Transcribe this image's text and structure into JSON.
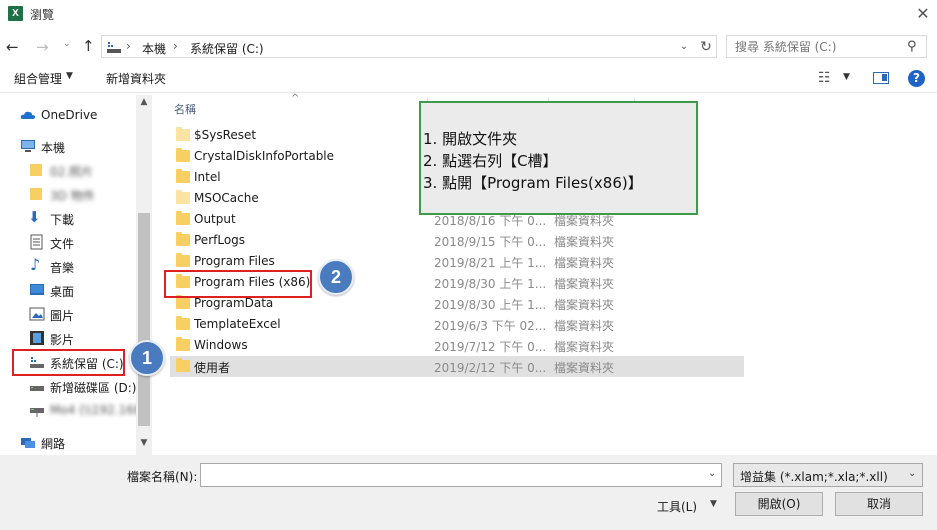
{
  "window": {
    "title": "瀏覽",
    "app_icon_letter": "X"
  },
  "address": {
    "crumbs": [
      "本機",
      "系統保留 (C:)"
    ],
    "separator": "›"
  },
  "search": {
    "placeholder": "搜尋 系統保留 (C:)"
  },
  "toolbar": {
    "organize": "組合管理",
    "new_folder": "新增資料夾"
  },
  "nav": {
    "items": [
      {
        "label": "OneDrive",
        "icon": "cloud-icon"
      },
      {
        "label": "本機",
        "icon": "computer-icon"
      },
      {
        "label": "02.照片",
        "icon": "folder-icon",
        "blurred": true
      },
      {
        "label": "3D 物件",
        "icon": "folder-icon",
        "blurred": true
      },
      {
        "label": "下載",
        "icon": "download-icon"
      },
      {
        "label": "文件",
        "icon": "document-icon"
      },
      {
        "label": "音樂",
        "icon": "music-icon"
      },
      {
        "label": "桌面",
        "icon": "desktop-icon"
      },
      {
        "label": "圖片",
        "icon": "pictures-icon"
      },
      {
        "label": "影片",
        "icon": "video-icon"
      },
      {
        "label": "系統保留 (C:)",
        "icon": "system-drive-icon"
      },
      {
        "label": "新增磁碟區 (D:)",
        "icon": "drive-icon"
      },
      {
        "label": "Mo4 (\\\\192.168)",
        "icon": "network-drive-icon",
        "blurred": true
      },
      {
        "label": "網路",
        "icon": "network-icon"
      }
    ]
  },
  "list": {
    "col_name": "名稱",
    "rows": [
      {
        "name": "$SysReset",
        "date": "",
        "type": "",
        "light": true
      },
      {
        "name": "CrystalDiskInfoPortable",
        "date": "",
        "type": ""
      },
      {
        "name": "Intel",
        "date": "",
        "type": ""
      },
      {
        "name": "MSOCache",
        "date": "",
        "type": "",
        "light": true
      },
      {
        "name": "Output",
        "date": "2018/8/16 下午 0...",
        "type": "檔案資料夾"
      },
      {
        "name": "PerfLogs",
        "date": "2018/9/15 下午 0...",
        "type": "檔案資料夾"
      },
      {
        "name": "Program Files",
        "date": "2019/8/21 上午 1...",
        "type": "檔案資料夾"
      },
      {
        "name": "Program Files (x86)",
        "date": "2019/8/30 上午 1...",
        "type": "檔案資料夾"
      },
      {
        "name": "ProgramData",
        "date": "2019/8/30 上午 1...",
        "type": "檔案資料夾"
      },
      {
        "name": "TemplateExcel",
        "date": "2019/6/3 下午 02...",
        "type": "檔案資料夾"
      },
      {
        "name": "Windows",
        "date": "2019/7/12 下午 0...",
        "type": "檔案資料夾"
      },
      {
        "name": "使用者",
        "date": "2019/2/12 下午 0...",
        "type": "檔案資料夾",
        "selected": true
      }
    ]
  },
  "instructions": [
    "1. 開啟文件夾",
    "2. 點選右列【C槽】",
    "3. 點開【Program Files(x86)】"
  ],
  "badges": [
    "1",
    "2"
  ],
  "bottom": {
    "filename_label": "檔案名稱(N):",
    "filename_value": "",
    "filetype": "增益集 (*.xlam;*.xla;*.xll)",
    "tools": "工具(L)",
    "open": "開啟(O)",
    "cancel": "取消"
  },
  "colors": {
    "highlight": "#e02020",
    "badge": "#4a7bbf",
    "instruction_border": "#3d9b4a"
  }
}
